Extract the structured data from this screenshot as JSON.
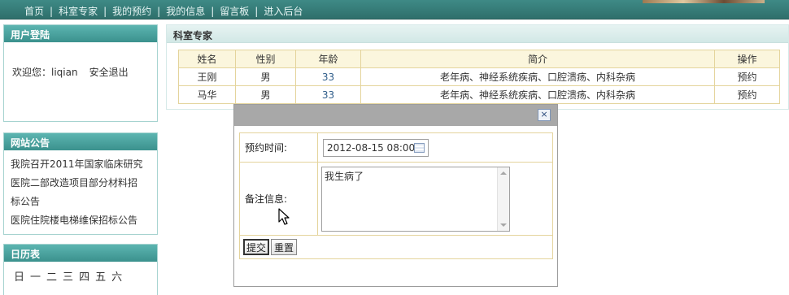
{
  "nav": {
    "items": [
      "首页",
      "科室专家",
      "我的预约",
      "我的信息",
      "留言板",
      "进入后台"
    ],
    "separator": "|"
  },
  "login": {
    "title": "用户登陆",
    "welcome": "欢迎您：liqian",
    "logout": "安全退出"
  },
  "notice": {
    "title": "网站公告",
    "items": [
      "我院召开2011年国家临床研究",
      "医院二部改造项目部分材料招",
      "标公告",
      "医院住院楼电梯维保招标公告"
    ]
  },
  "calendar": {
    "title": "日历表",
    "weekdays": [
      "日",
      "一",
      "二",
      "三",
      "四",
      "五",
      "六"
    ]
  },
  "main": {
    "title": "科室专家",
    "columns": [
      "姓名",
      "性别",
      "年龄",
      "简介",
      "操作"
    ],
    "rows": [
      [
        "王刚",
        "男",
        "33",
        "老年病、神经系统疾病、口腔溃疡、内科杂病",
        "预约"
      ],
      [
        "马华",
        "男",
        "33",
        "老年病、神经系统疾病、口腔溃疡、内科杂病",
        "预约"
      ]
    ]
  },
  "dialog": {
    "close_label": "×",
    "time_label": "预约时间:",
    "time_value": "2012-08-15 08:00",
    "note_label": "备注信息:",
    "note_value": "我生病了",
    "submit_label": "提交",
    "reset_label": "重置"
  }
}
